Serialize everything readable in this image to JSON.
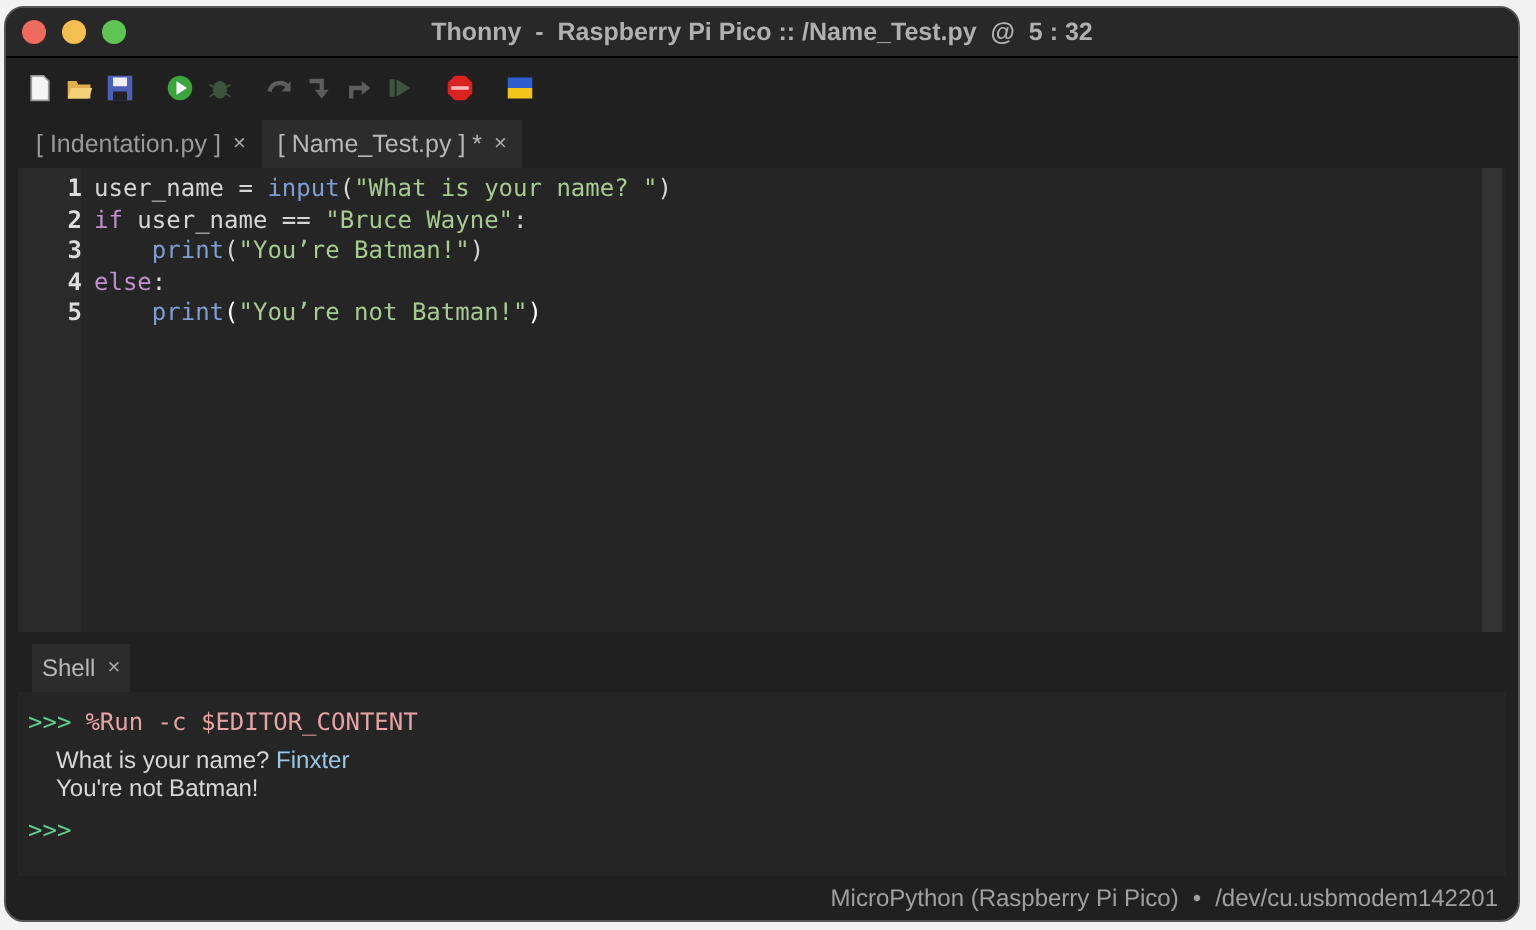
{
  "window": {
    "title": "Thonny  -  Raspberry Pi Pico :: /Name_Test.py  @  5 : 32"
  },
  "toolbar": [
    {
      "kind": "new"
    },
    {
      "kind": "open"
    },
    {
      "kind": "save"
    },
    {
      "kind": "run"
    },
    {
      "kind": "debug"
    },
    {
      "kind": "step-over"
    },
    {
      "kind": "step-into"
    },
    {
      "kind": "step-out"
    },
    {
      "kind": "resume"
    },
    {
      "kind": "stop"
    },
    {
      "kind": "flag"
    }
  ],
  "tabs": [
    {
      "label": "[ Indentation.py ]",
      "close": "×",
      "selected": false
    },
    {
      "label": "[ Name_Test.py ] *",
      "close": "×",
      "selected": true
    }
  ],
  "editor": {
    "lines": [
      {
        "number": "1",
        "indented": false,
        "tokens": [
          {
            "kind": "plain",
            "text": "user_name = "
          },
          {
            "kind": "builtin",
            "text": "input"
          },
          {
            "kind": "plain",
            "text": "("
          },
          {
            "kind": "string",
            "text": "\"What is your name? \""
          },
          {
            "kind": "plain",
            "text": ")"
          }
        ]
      },
      {
        "number": "2",
        "indented": false,
        "tokens": [
          {
            "kind": "keyword",
            "text": "if"
          },
          {
            "kind": "plain",
            "text": " user_name == "
          },
          {
            "kind": "string",
            "text": "\"Bruce Wayne\""
          },
          {
            "kind": "plain",
            "text": ":"
          }
        ]
      },
      {
        "number": "3",
        "indented": true,
        "tokens": [
          {
            "kind": "builtin",
            "text": "print"
          },
          {
            "kind": "plain",
            "text": "("
          },
          {
            "kind": "string",
            "text": "\"You’re Batman!\""
          },
          {
            "kind": "plain",
            "text": ")"
          }
        ]
      },
      {
        "number": "4",
        "indented": false,
        "tokens": [
          {
            "kind": "keyword",
            "text": "else"
          },
          {
            "kind": "plain",
            "text": ":"
          }
        ]
      },
      {
        "number": "5",
        "indented": true,
        "tokens": [
          {
            "kind": "builtin",
            "text": "print"
          },
          {
            "kind": "bracket",
            "text": "("
          },
          {
            "kind": "string",
            "text": "\"You’re not Batman!\""
          },
          {
            "kind": "bracket",
            "text": ")"
          }
        ]
      }
    ]
  },
  "shell": {
    "tab": {
      "label": "Shell",
      "close": "×",
      "selected": true
    },
    "lines": [
      {
        "kind": "command",
        "prompt": ">>>",
        "text": "%Run -c $EDITOR_CONTENT"
      },
      {
        "kind": "output",
        "text": "What is your name? ",
        "input": "Finxter"
      },
      {
        "kind": "output",
        "text": "You're not Batman!"
      },
      {
        "kind": "command",
        "prompt": ">>>"
      }
    ]
  },
  "status_bar": {
    "interpreter": "MicroPython (Raspberry Pi Pico)",
    "separator": "•",
    "port": "/dev/cu.usbmodem142201"
  }
}
